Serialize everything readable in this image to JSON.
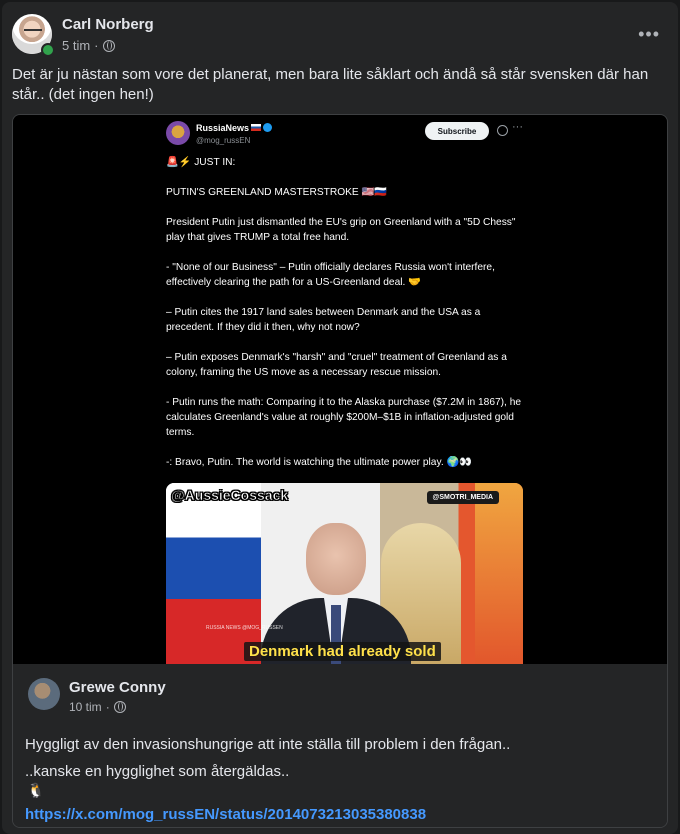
{
  "post": {
    "author": "Carl Norberg",
    "time": "5 tim",
    "separator": "·",
    "more_glyph": "•••",
    "text": "Det är ju nästan som vore det planerat, men bara lite såklart och ändå så står svensken där han står.. (det ingen hen!)"
  },
  "tweet": {
    "name": "RussiaNews",
    "handle": "@mog_russEN",
    "subscribe_label": "Subscribe",
    "more_glyph": "···",
    "lines": [
      "🚨⚡ JUST IN:",
      "PUTIN'S GREENLAND MASTERSTROKE 🇺🇸🇷🇺",
      "President Putin just dismantled the EU's grip on Greenland with a \"5D Chess\" play that gives TRUMP a total free hand.",
      "- \"None of our Business\" – Putin officially declares Russia won't interfere, effectively clearing the path for a US-Greenland deal. 🤝",
      "– Putin cites the 1917 land sales between Denmark and the USA as a precedent. If they did it then, why not now?",
      "– Putin exposes Denmark's \"harsh\" and \"cruel\" treatment of Greenland as a colony, framing the US move as a necessary rescue mission.",
      "- Putin runs the math: Comparing it to the Alaska purchase ($7.2M in 1867), he calculates Greenland's value at roughly $200M–$1B in inflation-adjusted gold terms.",
      "-: Bravo, Putin. The world is watching the ultimate power play. 🌍👀"
    ],
    "video": {
      "tag": "@AussieCossack",
      "badge": "@SMOTRI_MEDIA",
      "watermark": "RUSSIA NEWS  @MOG_RUSSEN",
      "caption": "Denmark had already sold"
    }
  },
  "shared_footer": {
    "author": "Grewe Conny",
    "time": "10 tim",
    "separator": "·",
    "line1": "Hyggligt av den invasionshungrige att inte ställa till problem i den frågan..",
    "line2": "..kanske en hygglighet som återgäldas..",
    "emoji": "🐧",
    "link": "https://x.com/mog_russEN/status/2014073213035380838"
  },
  "colors": {
    "page_bg": "#18191a",
    "card_bg": "#242526",
    "text": "#e4e6eb",
    "muted": "#b0b3b8",
    "link": "#4599ff",
    "online": "#31a24c"
  }
}
